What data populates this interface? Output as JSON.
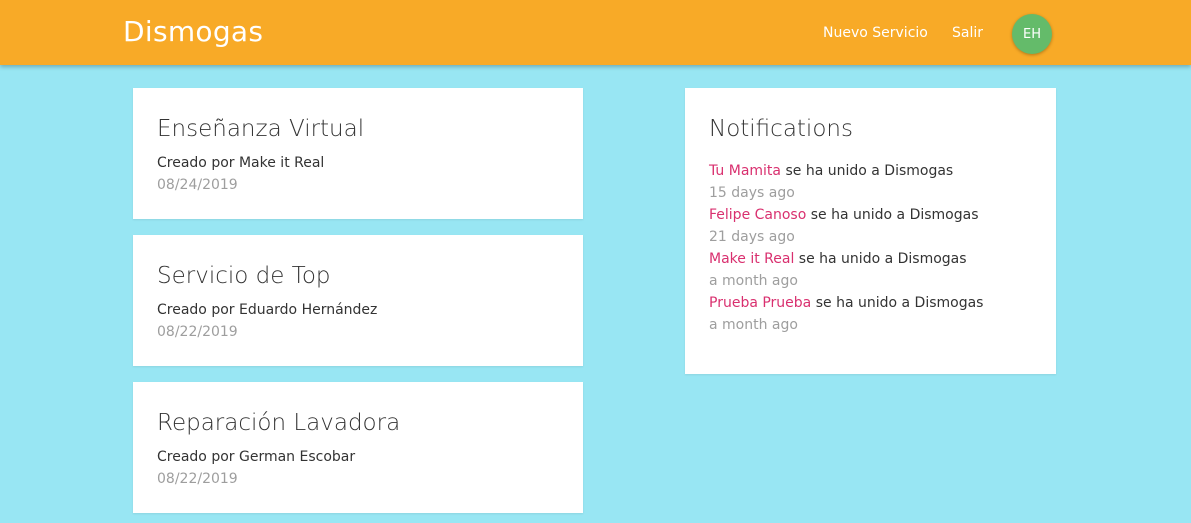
{
  "header": {
    "brand": "Dismogas",
    "nav": {
      "new_service": "Nuevo Servicio",
      "logout": "Salir"
    },
    "avatar_initials": "EH"
  },
  "services": [
    {
      "title": "Enseñanza Virtual",
      "created_by": "Creado por Make it Real",
      "date": "08/24/2019"
    },
    {
      "title": "Servicio de Top",
      "created_by": "Creado por Eduardo Hernández",
      "date": "08/22/2019"
    },
    {
      "title": "Reparación Lavadora",
      "created_by": "Creado por German Escobar",
      "date": "08/22/2019"
    }
  ],
  "notifications": {
    "title": "Notifications",
    "items": [
      {
        "user": "Tu Mamita",
        "text": "se ha unido a Dismogas",
        "time": "15 days ago"
      },
      {
        "user": "Felipe Canoso",
        "text": "se ha unido a Dismogas",
        "time": "21 days ago"
      },
      {
        "user": "Make it Real",
        "text": "se ha unido a Dismogas",
        "time": "a month ago"
      },
      {
        "user": "Prueba Prueba",
        "text": "se ha unido a Dismogas",
        "time": "a month ago"
      }
    ]
  },
  "colors": {
    "background": "#98E6F3",
    "header": "#F8AA27",
    "avatar": "#64BB6A",
    "link_accent": "#D9306F",
    "muted_text": "#9E9E9E"
  }
}
